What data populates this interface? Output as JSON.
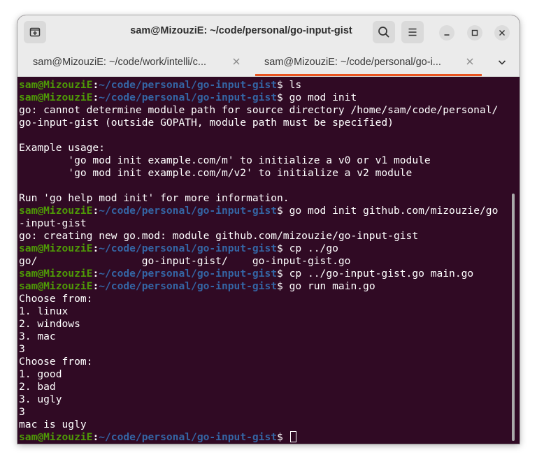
{
  "window": {
    "title": "sam@MizouziE: ~/code/personal/go-input-gist"
  },
  "titlebar_icons": {
    "new_tab": "new-tab-icon",
    "search": "search-icon",
    "menu": "hamburger-menu-icon",
    "minimize": "minimize-icon",
    "maximize": "maximize-icon",
    "close": "close-icon"
  },
  "tabs": [
    {
      "label": "sam@MizouziE: ~/code/work/intelli/c...",
      "active": false
    },
    {
      "label": "sam@MizouziE: ~/code/personal/go-i...",
      "active": true
    }
  ],
  "colors": {
    "terminal_bg": "#300a24",
    "prompt_user": "#4e9a06",
    "prompt_path": "#3465a4",
    "text": "#ffffff",
    "active_tab_accent": "#e95420"
  },
  "prompt": {
    "user": "sam@MizouziE",
    "path": "~/code/personal/go-input-gist"
  },
  "terminal": {
    "lines": [
      {
        "user": "sam@MizouziE",
        "sep": ":",
        "path": "~/code/personal/go-input-gist",
        "cmd": "$ ls"
      },
      {
        "user": "sam@MizouziE",
        "sep": ":",
        "path": "~/code/personal/go-input-gist",
        "cmd": "$ go mod init"
      },
      {
        "text": "go: cannot determine module path for source directory /home/sam/code/personal/"
      },
      {
        "text": "go-input-gist (outside GOPATH, module path must be specified)"
      },
      {
        "text": ""
      },
      {
        "text": "Example usage:"
      },
      {
        "text": "        'go mod init example.com/m' to initialize a v0 or v1 module"
      },
      {
        "text": "        'go mod init example.com/m/v2' to initialize a v2 module"
      },
      {
        "text": ""
      },
      {
        "text": "Run 'go help mod init' for more information."
      },
      {
        "user": "sam@MizouziE",
        "sep": ":",
        "path": "~/code/personal/go-input-gist",
        "cmd": "$ go mod init github.com/mizouzie/go"
      },
      {
        "text": "-input-gist"
      },
      {
        "text": "go: creating new go.mod: module github.com/mizouzie/go-input-gist"
      },
      {
        "user": "sam@MizouziE",
        "sep": ":",
        "path": "~/code/personal/go-input-gist",
        "cmd": "$ cp ../go"
      },
      {
        "text": "go/                 go-input-gist/    go-input-gist.go"
      },
      {
        "user": "sam@MizouziE",
        "sep": ":",
        "path": "~/code/personal/go-input-gist",
        "cmd": "$ cp ../go-input-gist.go main.go"
      },
      {
        "user": "sam@MizouziE",
        "sep": ":",
        "path": "~/code/personal/go-input-gist",
        "cmd": "$ go run main.go"
      },
      {
        "text": "Choose from:"
      },
      {
        "text": "1. linux"
      },
      {
        "text": "2. windows"
      },
      {
        "text": "3. mac"
      },
      {
        "text": "3"
      },
      {
        "text": "Choose from:"
      },
      {
        "text": "1. good"
      },
      {
        "text": "2. bad"
      },
      {
        "text": "3. ugly"
      },
      {
        "text": "3"
      },
      {
        "text": "mac is ugly"
      },
      {
        "user": "sam@MizouziE",
        "sep": ":",
        "path": "~/code/personal/go-input-gist",
        "cmd": "$ ",
        "cursor": true
      }
    ]
  }
}
